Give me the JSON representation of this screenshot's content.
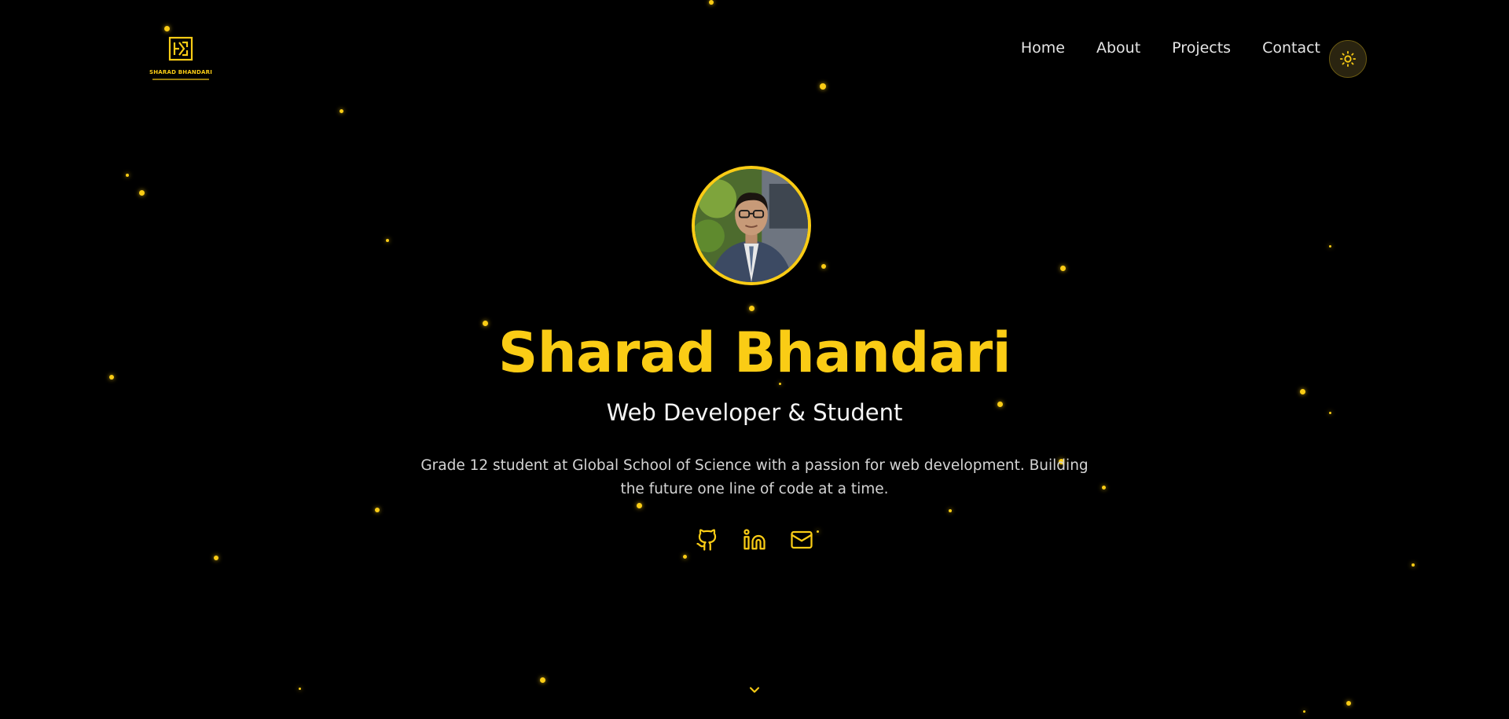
{
  "logo": {
    "text": "SHARAD BHANDARI",
    "icon": "sb-monogram-icon"
  },
  "nav": {
    "items": [
      "Home",
      "About",
      "Projects",
      "Contact"
    ],
    "theme_toggle_icon": "sun-icon"
  },
  "hero": {
    "avatar_icon": "profile-photo",
    "name": "Sharad Bhandari",
    "role": "Web Developer & Student",
    "bio": "Grade 12 student at Global School of Science with a passion for web development. Building the future one line of code at a time.",
    "socials": [
      {
        "icon": "github-icon"
      },
      {
        "icon": "linkedin-icon"
      },
      {
        "icon": "mail-icon"
      }
    ],
    "scroll_icon": "chevron-down-icon"
  },
  "colors": {
    "accent": "#facc15",
    "background": "#000000",
    "text": "#ffffff"
  }
}
